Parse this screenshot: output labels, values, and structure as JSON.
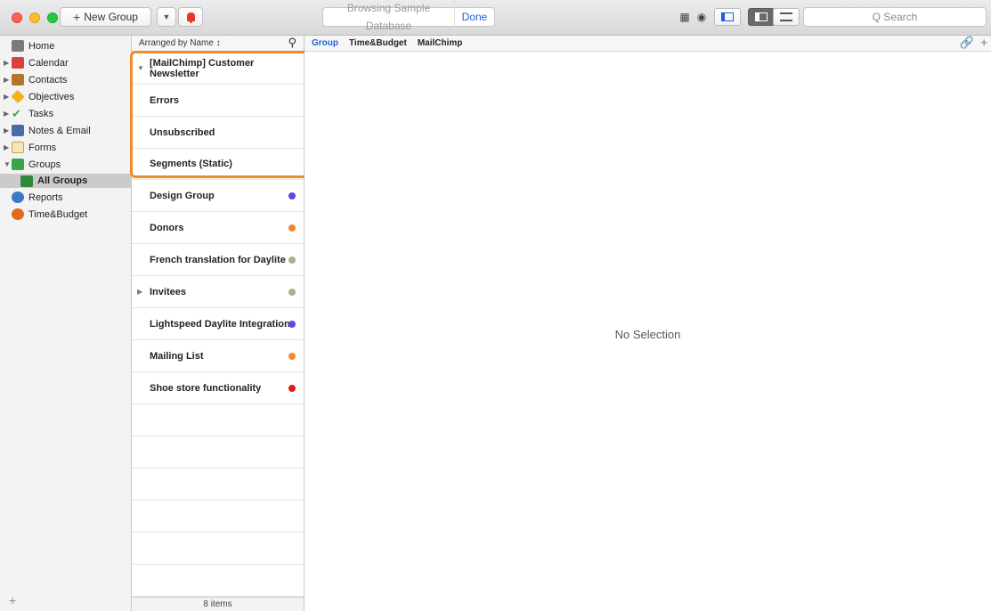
{
  "toolbar": {
    "new_group_label": "New Group",
    "browse_text": "Browsing Sample Database",
    "done_label": "Done",
    "search_placeholder": "Q Search"
  },
  "sidebar": {
    "items": [
      {
        "label": "Home",
        "icon": "home-icon",
        "color": "#6a6a6a"
      },
      {
        "label": "Calendar",
        "icon": "calendar-icon",
        "color": "#d6443c"
      },
      {
        "label": "Contacts",
        "icon": "contacts-icon",
        "color": "#b4772a"
      },
      {
        "label": "Objectives",
        "icon": "objectives-icon",
        "color": "#f3b21a"
      },
      {
        "label": "Tasks",
        "icon": "tasks-icon",
        "color": "#3cae3a"
      },
      {
        "label": "Notes & Email",
        "icon": "notes-icon",
        "color": "#4a6aa8"
      },
      {
        "label": "Forms",
        "icon": "forms-icon",
        "color": "#e8b34a"
      },
      {
        "label": "Groups",
        "icon": "groups-icon",
        "color": "#3ba34a"
      },
      {
        "label": "All Groups",
        "icon": "all-groups-icon",
        "color": "#3ba34a"
      },
      {
        "label": "Reports",
        "icon": "reports-icon",
        "color": "#3a78c8"
      },
      {
        "label": "Time&Budget",
        "icon": "timebudget-icon",
        "color": "#e06a1a"
      }
    ]
  },
  "list": {
    "sort_label": "Arranged by Name ↕",
    "rows": [
      {
        "label": "[MailChimp] Customer Newsletter",
        "dot": ""
      },
      {
        "label": "Errors",
        "dot": ""
      },
      {
        "label": "Unsubscribed",
        "dot": ""
      },
      {
        "label": "Segments (Static)",
        "dot": ""
      },
      {
        "label": "Design Group",
        "dot": "#5b4be0"
      },
      {
        "label": "Donors",
        "dot": "#f08a2c"
      },
      {
        "label": "French translation for Daylite",
        "dot": "#a9b48a"
      },
      {
        "label": "Invitees",
        "dot": "#a9b48a"
      },
      {
        "label": "Lightspeed Daylite Integration",
        "dot": "#5b4be0"
      },
      {
        "label": "Mailing List",
        "dot": "#f08a2c"
      },
      {
        "label": "Shoe store functionality",
        "dot": "#e01a1a"
      }
    ],
    "footer": "8 items"
  },
  "detail": {
    "tabs": [
      "Group",
      "Time&Budget",
      "MailChimp"
    ],
    "no_selection": "No Selection"
  }
}
